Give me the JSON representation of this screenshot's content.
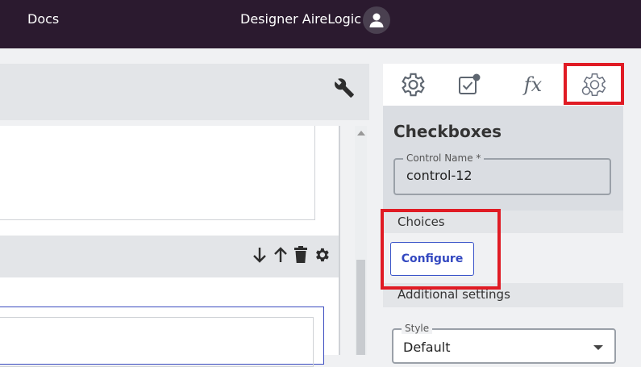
{
  "topbar": {
    "docs_label": "Docs",
    "user_label": "Designer AireLogic"
  },
  "panel": {
    "tabs": [
      {
        "name": "settings",
        "icon": "gear-icon"
      },
      {
        "name": "validation",
        "icon": "checkbox-edit-icon"
      },
      {
        "name": "expressions",
        "label": "fx",
        "icon": "function-icon"
      },
      {
        "name": "advanced-settings",
        "icon": "gear-outline-icon"
      }
    ],
    "control_title": "Checkboxes",
    "control_name": {
      "label": "Control Name *",
      "value": "control-12"
    },
    "choices": {
      "heading": "Choices",
      "configure_label": "Configure"
    },
    "additional_settings": {
      "heading": "Additional settings",
      "style_label": "Style",
      "style_value": "Default"
    }
  },
  "canvas_tools": [
    "arrow-down-icon",
    "arrow-up-icon",
    "trash-icon",
    "gear-icon"
  ],
  "colors": {
    "topbar": "#2b1a2f",
    "highlight": "#e01b24",
    "accent": "#3348c0"
  }
}
